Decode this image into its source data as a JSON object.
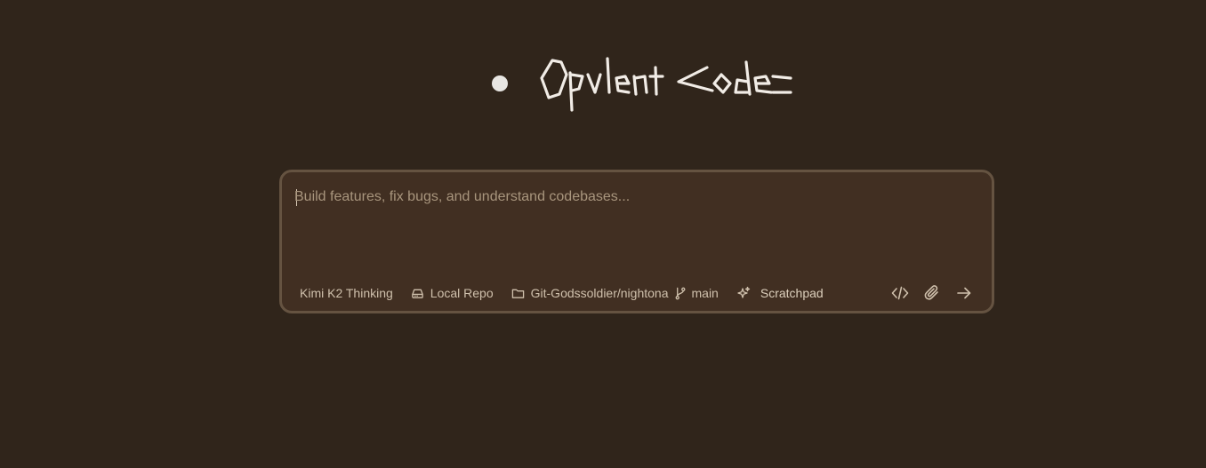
{
  "app": {
    "title": "Opvlent Code"
  },
  "composer": {
    "placeholder": "Build features, fix bugs, and understand codebases...",
    "value": ""
  },
  "toolbar": {
    "model_label": "Kimi K2 Thinking",
    "repo_label": "Local Repo",
    "folder_label": "Git-Godssoldier/nightona",
    "branch_label": "main",
    "scratchpad_label": "Scratchpad"
  },
  "icons": {
    "repo": "hard-drive-icon",
    "folder": "folder-icon",
    "branch": "git-branch-icon",
    "scratchpad": "sparkles-icon",
    "code": "code-icon",
    "attach": "paperclip-icon",
    "send": "arrow-right-icon"
  },
  "colors": {
    "background": "#30251b",
    "composer_bg": "#412f22",
    "composer_border": "#655341",
    "text": "#cfc0ac",
    "placeholder": "#a8957d",
    "logo": "#f1ece6"
  }
}
